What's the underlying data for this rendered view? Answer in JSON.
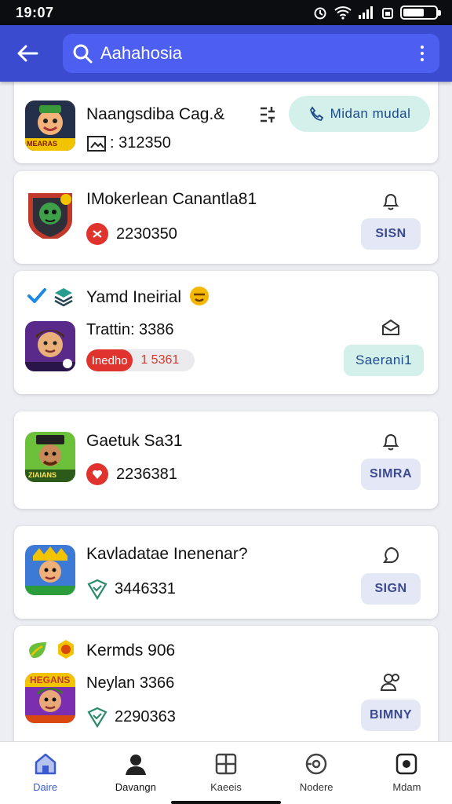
{
  "status_bar": {
    "time": "19:07"
  },
  "header": {
    "search_text": "Aahahosia"
  },
  "items": [
    {
      "title": "Naangsdiba Cag.&",
      "value": ": 312350",
      "action": "Midan mudal",
      "icon_label": "MEARAS"
    },
    {
      "title": "IMokerlean Canantla81",
      "value": "2230350",
      "action": "SISN"
    },
    {
      "title": "Yamd Ineirial",
      "value": "Trattin: 3386",
      "progress_label": "Inedho",
      "progress_value": "1 5361",
      "progress_fraction": 0.43,
      "action": "Saerani1"
    },
    {
      "title": "Gaetuk Sa31",
      "value": "2236381",
      "action": "SIMRA",
      "icon_label": "ZIAIANS"
    },
    {
      "title": "Kavladatae Inenenar?",
      "value": "3446331",
      "action": "SIGN"
    },
    {
      "title": "Kermds 906",
      "value": "Neylan 3366",
      "value2": "2290363",
      "action": "BIMNY",
      "icon_label": "HEGANS"
    }
  ],
  "nav": [
    {
      "label": "Daire",
      "icon": "home-icon"
    },
    {
      "label": "Davangn",
      "icon": "person-icon"
    },
    {
      "label": "Kaeeis",
      "icon": "grid-icon"
    },
    {
      "label": "Nodere",
      "icon": "disc-icon"
    },
    {
      "label": "Mdam",
      "icon": "record-icon"
    }
  ]
}
